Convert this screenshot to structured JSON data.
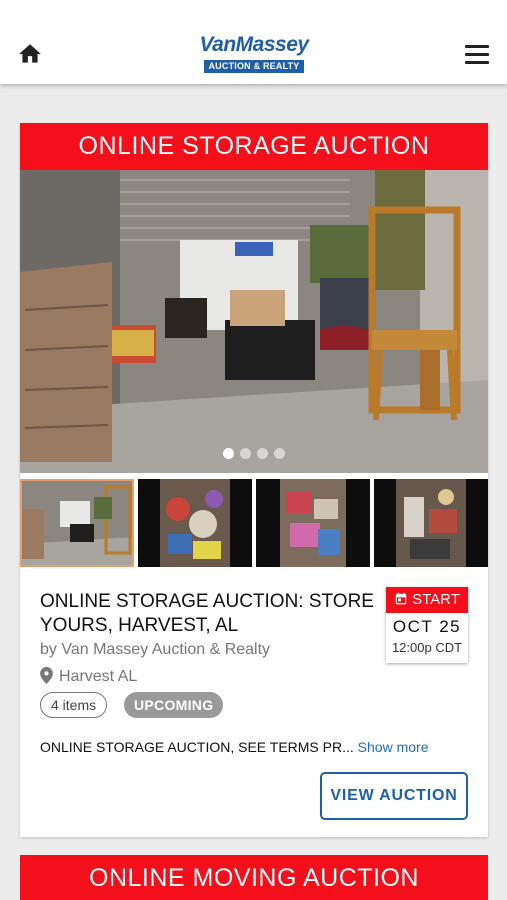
{
  "header": {
    "logo_name": "VanMassey",
    "logo_sub": "AUCTION & REALTY"
  },
  "icons": {
    "home": "home-icon",
    "menu": "hamburger-menu-icon",
    "location": "map-pin-icon",
    "calendar": "calendar-icon"
  },
  "colors": {
    "banner_red": "#f40f1b",
    "brand_blue": "#1f5fa8",
    "link_blue": "#1f6fb2",
    "status_gray": "#9a9a9a"
  },
  "auction": {
    "banner": "ONLINE STORAGE AUCTION",
    "carousel_index": 1,
    "carousel_count": 4,
    "title": "ONLINE STORAGE AUCTION: STORE YOURS, HARVEST, AL",
    "byline": "by Van Massey Auction & Realty",
    "location": "Harvest AL",
    "items_count": "4 items",
    "status": "UPCOMING",
    "date": {
      "label": "START",
      "day": "OCT 25",
      "time": "12:00p CDT"
    },
    "description": "ONLINE STORAGE AUCTION, SEE TERMS PR...",
    "show_more": "Show more",
    "view_button": "VIEW AUCTION"
  },
  "next_auction": {
    "banner": "ONLINE MOVING AUCTION"
  }
}
